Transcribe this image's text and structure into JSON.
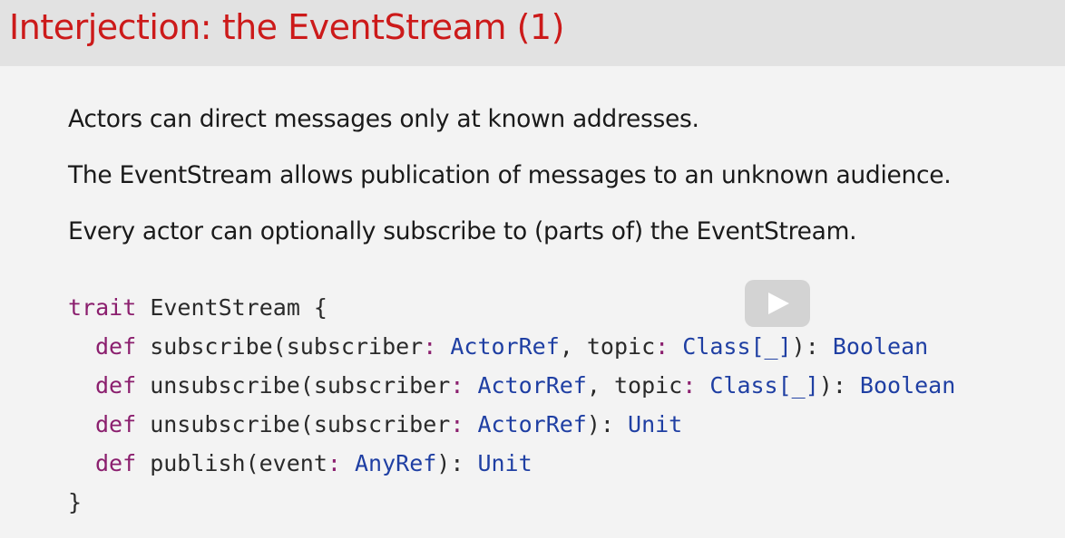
{
  "slide": {
    "title": "Interjection: the EventStream (1)",
    "paragraphs": [
      "Actors can direct messages only at known addresses.",
      "The EventStream allows publication of messages to an unknown audience.",
      "Every actor can optionally subscribe to (parts of) the EventStream."
    ],
    "code": {
      "line0": {
        "kw": "trait",
        "rest": " EventStream {"
      },
      "line1": {
        "kw": "def",
        "name": " subscribe(subscriber",
        "p1": ": ",
        "t1": "ActorRef",
        "mid": ", topic",
        "p2": ": ",
        "t2": "Class[_]",
        "end": "): ",
        "t3": "Boolean"
      },
      "line2": {
        "kw": "def",
        "name": " unsubscribe(subscriber",
        "p1": ": ",
        "t1": "ActorRef",
        "mid": ", topic",
        "p2": ": ",
        "t2": "Class[_]",
        "end": "): ",
        "t3": "Boolean"
      },
      "line3": {
        "kw": "def",
        "name": " unsubscribe(subscriber",
        "p1": ": ",
        "t1": "ActorRef",
        "end": "): ",
        "t3": "Unit"
      },
      "line4": {
        "kw": "def",
        "name": " publish(event",
        "p1": ": ",
        "t1": "AnyRef",
        "end": "): ",
        "t3": "Unit"
      },
      "line5": {
        "rest": "}"
      }
    }
  },
  "overlay": {
    "play_icon": "play-icon"
  },
  "colors": {
    "title": "#cc1a1a",
    "keyword": "#8b1f6e",
    "type": "#1f3fa3",
    "background": "#f3f3f3",
    "title_bar": "#e2e2e2"
  }
}
